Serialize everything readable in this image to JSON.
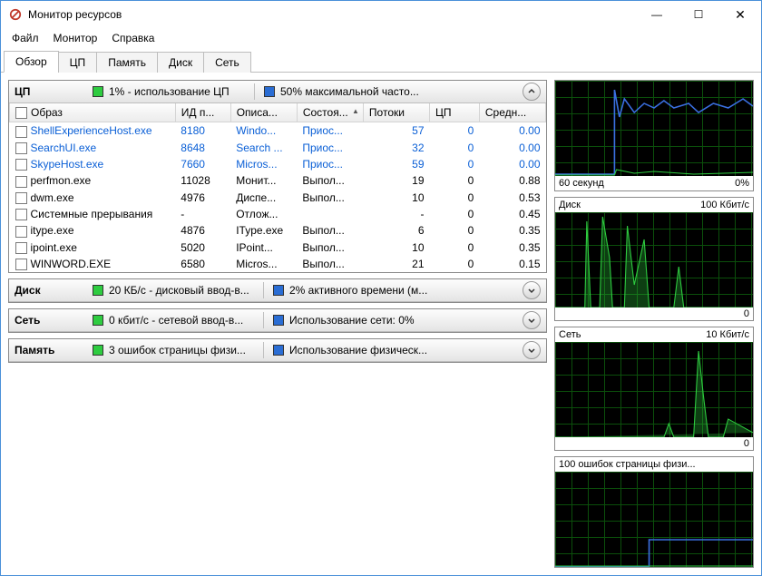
{
  "window": {
    "title": "Монитор ресурсов"
  },
  "menu": {
    "file": "Файл",
    "monitor": "Монитор",
    "help": "Справка"
  },
  "tabs": {
    "overview": "Обзор",
    "cpu": "ЦП",
    "memory": "Память",
    "disk": "Диск",
    "network": "Сеть"
  },
  "cpu_panel": {
    "label": "ЦП",
    "stat1": "1% - использование ЦП",
    "stat2": "50% максимальной часто...",
    "columns": {
      "image": "Образ",
      "pid": "ИД п...",
      "desc": "Описа...",
      "state": "Состоя...",
      "threads": "Потоки",
      "cpu": "ЦП",
      "avg": "Средн..."
    },
    "rows": [
      {
        "img": "ShellExperienceHost.exe",
        "pid": "8180",
        "desc": "Windo...",
        "state": "Приос...",
        "threads": "57",
        "cpu": "0",
        "avg": "0.00",
        "susp": true
      },
      {
        "img": "SearchUI.exe",
        "pid": "8648",
        "desc": "Search ...",
        "state": "Приос...",
        "threads": "32",
        "cpu": "0",
        "avg": "0.00",
        "susp": true
      },
      {
        "img": "SkypeHost.exe",
        "pid": "7660",
        "desc": "Micros...",
        "state": "Приос...",
        "threads": "59",
        "cpu": "0",
        "avg": "0.00",
        "susp": true
      },
      {
        "img": "perfmon.exe",
        "pid": "11028",
        "desc": "Монит...",
        "state": "Выпол...",
        "threads": "19",
        "cpu": "0",
        "avg": "0.88",
        "susp": false
      },
      {
        "img": "dwm.exe",
        "pid": "4976",
        "desc": "Диспе...",
        "state": "Выпол...",
        "threads": "10",
        "cpu": "0",
        "avg": "0.53",
        "susp": false
      },
      {
        "img": "Системные прерывания",
        "pid": "-",
        "desc": "Отлож...",
        "state": "",
        "threads": "-",
        "cpu": "0",
        "avg": "0.45",
        "susp": false
      },
      {
        "img": "itype.exe",
        "pid": "4876",
        "desc": "IType.exe",
        "state": "Выпол...",
        "threads": "6",
        "cpu": "0",
        "avg": "0.35",
        "susp": false
      },
      {
        "img": "ipoint.exe",
        "pid": "5020",
        "desc": "IPoint...",
        "state": "Выпол...",
        "threads": "10",
        "cpu": "0",
        "avg": "0.35",
        "susp": false
      },
      {
        "img": "WINWORD.EXE",
        "pid": "6580",
        "desc": "Micros...",
        "state": "Выпол...",
        "threads": "21",
        "cpu": "0",
        "avg": "0.15",
        "susp": false
      }
    ]
  },
  "disk_panel": {
    "label": "Диск",
    "stat1": "20 КБ/с - дисковый ввод-в...",
    "stat2": "2% активного времени (м..."
  },
  "net_panel": {
    "label": "Сеть",
    "stat1": "0 кбит/с - сетевой ввод-в...",
    "stat2": "Использование сети: 0%"
  },
  "mem_panel": {
    "label": "Память",
    "stat1": "3 ошибок страницы физи...",
    "stat2": "Использование физическ..."
  },
  "graphs": {
    "cpu": {
      "footer_left": "60 секунд",
      "footer_right": "0%"
    },
    "disk": {
      "title": "Диск",
      "scale": "100 Кбит/с",
      "footer_right": "0"
    },
    "net": {
      "title": "Сеть",
      "scale": "10 Кбит/с",
      "footer_right": "0"
    },
    "mem": {
      "title": "100 ошибок страницы физи..."
    }
  }
}
